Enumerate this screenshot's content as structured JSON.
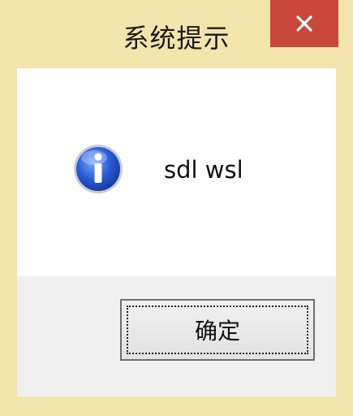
{
  "window": {
    "title": "系统提示",
    "accent_color": "#f3e5ab",
    "close_button_color": "#c9463d"
  },
  "titlebar": {
    "close_icon": "close-icon"
  },
  "message": {
    "icon": "info-icon",
    "text": "sdl wsl"
  },
  "buttons": {
    "ok_label": "确定"
  }
}
